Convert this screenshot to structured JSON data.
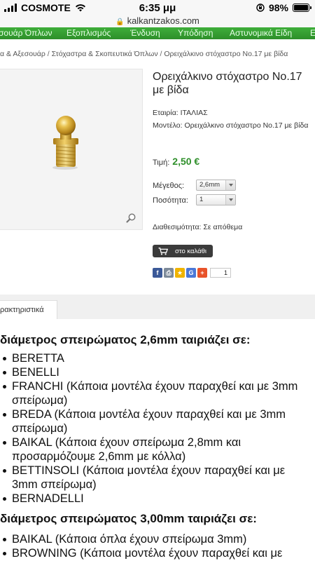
{
  "status_bar": {
    "carrier": "COSMOTE",
    "time": "6:35 μμ",
    "battery": "98%",
    "battery_level": 0.98
  },
  "url_bar": {
    "url": "kalkantzakos.com"
  },
  "nav": {
    "items": [
      "σουάρ Όπλων",
      "Εξοπλισμός",
      "Ένδυση",
      "Υπόδηση",
      "Αστυνομικά Είδη",
      "Ε"
    ]
  },
  "breadcrumb": {
    "items": [
      "α & Αξεσουάρ",
      "Στόχαστρα & Σκοπευτικά Όπλων",
      "Ορειχάλκινο στόχαστρο Νο.17 με βίδα"
    ],
    "separator": " / "
  },
  "product": {
    "title": "Ορειχάλκινο στόχαστρο Νο.17 με βίδα",
    "company_label": "Εταιρία:",
    "company": "ΙΤΑΛΙΑΣ",
    "model_label": "Μοντέλο:",
    "model": "Ορειχάλκινο στόχαστρο Νο.17 με βίδα",
    "price_label": "Τιμή:",
    "price": "2,50 €",
    "size_label": "Μέγεθος:",
    "size_value": "2,6mm",
    "quantity_label": "Ποσότητα:",
    "quantity_value": "1",
    "availability_label": "Διαθεσιμότητα:",
    "availability": "Σε απόθεμα",
    "cart_label": "στο καλάθι",
    "share_count": "1",
    "accent_color": "#2e8f2a"
  },
  "share": {
    "icons": [
      "facebook-icon",
      "print-icon",
      "favorite-star-icon",
      "google-icon",
      "add-plus-icon"
    ]
  },
  "tabs": {
    "active": "ρακτηριστικά"
  },
  "description": {
    "sections": [
      {
        "heading": "διάμετρος σπειρώματος 2,6mm ταιριάζει σε:",
        "items": [
          "BERETTA",
          "BENELLI",
          "FRANCHI (Κάποια μοντέλα έχουν παραχθεί και με 3mm σπείρωμα)",
          "BREDA (Κάποια μοντέλα έχουν παραχθεί και με 3mm σπείρωμα)",
          "BAIKAL (Κάποια έχουν σπείρωμα 2,8mm και προσαρμόζουμε 2,6mm με κόλλα)",
          "BETTINSOLI (Κάποια μοντέλα έχουν παραχθεί και με 3mm σπείρωμα)",
          "BERNADELLI"
        ]
      },
      {
        "heading": "διάμετρος σπειρώματος 3,00mm ταιριάζει σε:",
        "items": [
          "BAIKAL (Κάποια όπλα έχουν σπείρωμα 3mm)",
          "BROWNING (Κάποια μοντέλα έχουν παραχθεί και με"
        ]
      }
    ]
  }
}
